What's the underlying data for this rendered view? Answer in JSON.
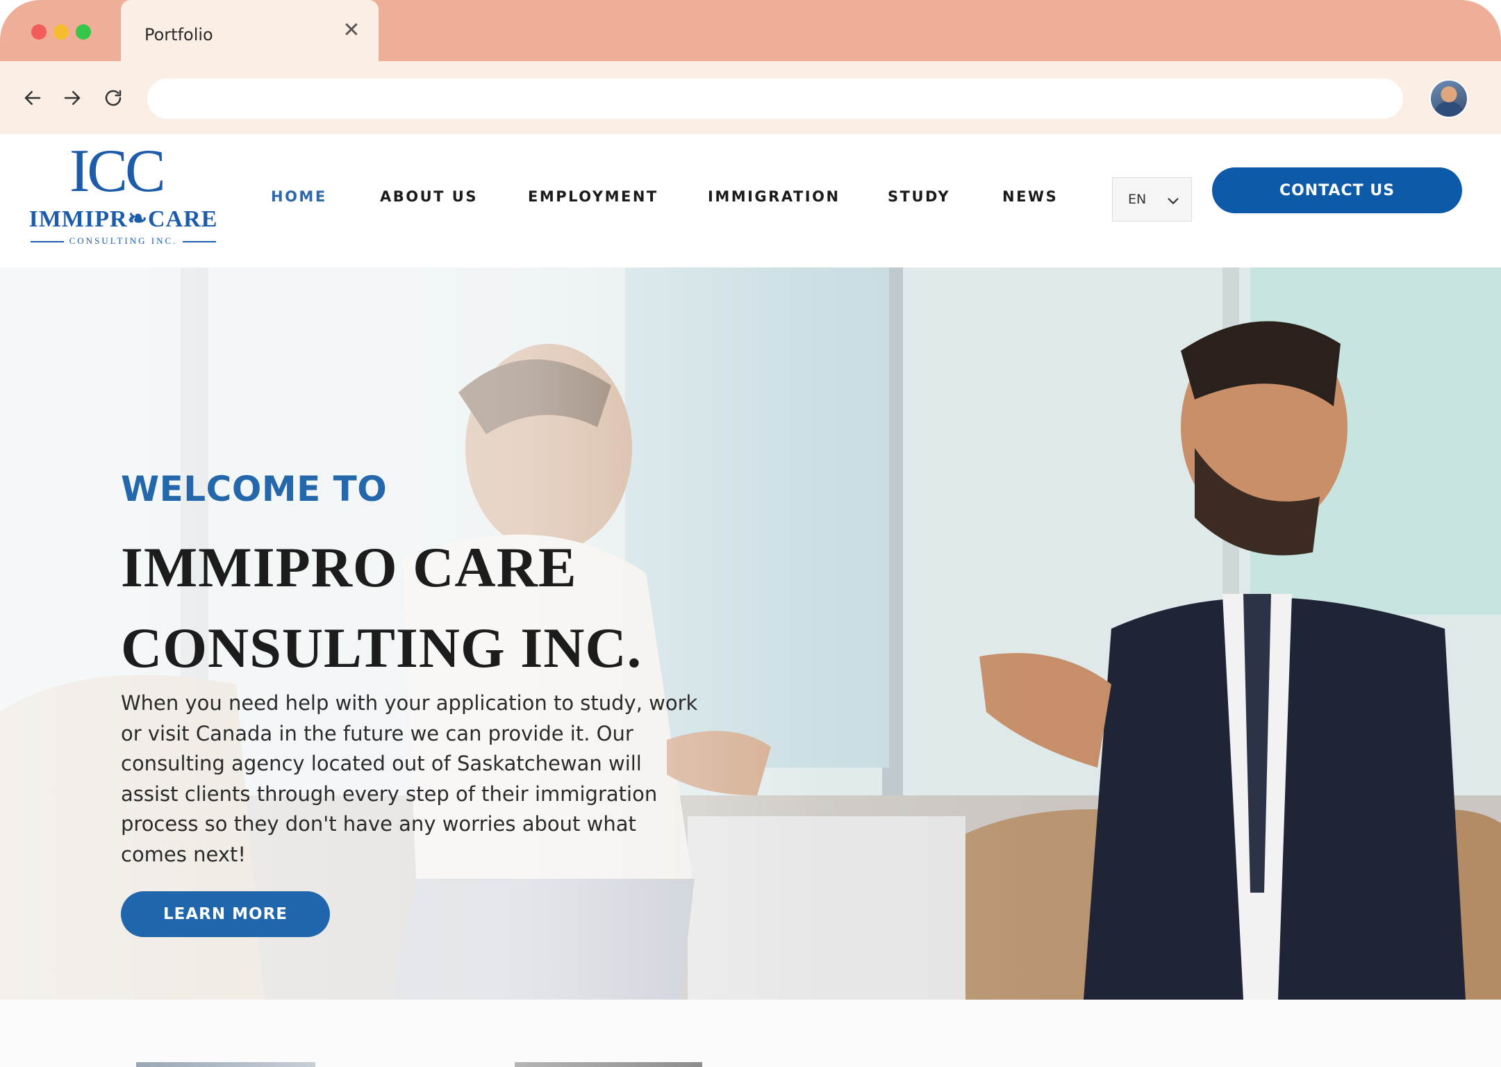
{
  "browser": {
    "tab_title": "Portfolio",
    "tab_close_icon": "close-icon",
    "url_value": "",
    "url_placeholder": ""
  },
  "site": {
    "logo": {
      "mark": "ICC",
      "name": "IMMIPR❧CARE",
      "subtitle": "CONSULTING INC."
    },
    "menu": [
      {
        "label": "HOME",
        "active": true
      },
      {
        "label": "ABOUT US",
        "active": false
      },
      {
        "label": "EMPLOYMENT",
        "active": false
      },
      {
        "label": "IMMIGRATION",
        "active": false
      },
      {
        "label": "STUDY",
        "active": false
      },
      {
        "label": "NEWS",
        "active": false
      }
    ],
    "language": {
      "selected": "EN"
    },
    "contact_label": "CONTACT US"
  },
  "hero": {
    "welcome": "WELCOME TO",
    "title_line1": "IMMIPRO CARE",
    "title_line2": "CONSULTING INC.",
    "text": "When you need help with your application to study, work or visit Canada in the future we can provide it. Our consulting agency located out of Saskatchewan will assist clients through every step of their immigration process so they don't have any worries about what comes next!",
    "button_label": "LEARN MORE"
  },
  "colors": {
    "chrome_tabbar": "#efae97",
    "chrome_toolbar": "#fbeee5",
    "brand_blue": "#0d5aa8",
    "menu_active": "#2e68a8",
    "heading_blue": "#2467ab"
  }
}
